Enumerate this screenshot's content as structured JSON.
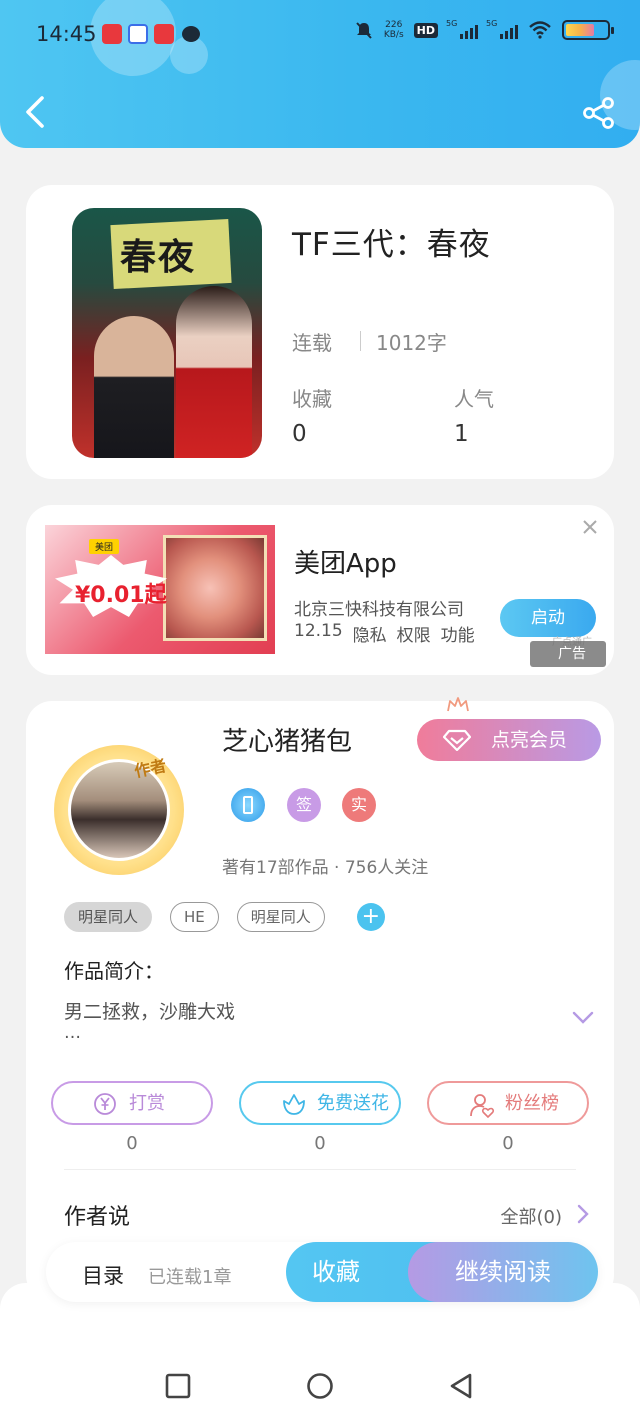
{
  "status_bar": {
    "time": "14:45",
    "net_speed": "226",
    "net_unit": "KB/s",
    "hd": "HD",
    "sig1_label": "5G",
    "sig2_label": "5G"
  },
  "header": {
    "back_icon": "chevron-left-icon",
    "share_icon": "share-icon"
  },
  "book": {
    "cover_text": "春夜",
    "title": "TF三代：春夜",
    "status": "连载",
    "word_count": "1012字",
    "stats": [
      {
        "label": "收藏",
        "value": "0"
      },
      {
        "label": "人气",
        "value": "1"
      }
    ]
  },
  "ad": {
    "image_logo": "美团",
    "image_price": "¥0.01起",
    "app_name": "美团App",
    "company": "北京三快科技有限公司",
    "meta": [
      "12.15",
      "隐私",
      "权限",
      "功能"
    ],
    "launch_label": "启动",
    "badge_label": "广告",
    "badge_tiny": "广点通广"
  },
  "author": {
    "name": "芝心猪猪包",
    "avatar_tag": "作者",
    "vip_label": "点亮会员",
    "badges": [
      "签",
      "实"
    ],
    "stats_text": "著有17部作品 · 756人关注",
    "tags": [
      "明星同人",
      "HE",
      "明星同人"
    ],
    "tag_add": "+",
    "intro_label": "作品简介：",
    "intro_text": "男二拯救，沙雕大戏",
    "intro_more": "…",
    "actions": [
      {
        "label": "打赏",
        "count": "0"
      },
      {
        "label": "免费送花",
        "count": "0"
      },
      {
        "label": "粉丝榜",
        "count": "0"
      }
    ],
    "said_label": "作者说",
    "said_all": "全部(0)"
  },
  "bottom_bar": {
    "toc_label": "目录",
    "toc_status": "已连载1章",
    "fav_label": "收藏",
    "read_label": "继续阅读"
  },
  "colors": {
    "accent_blue": "#3bb8ef",
    "vip_pink": "#f07c9a",
    "vip_purple": "#b99ae5"
  }
}
